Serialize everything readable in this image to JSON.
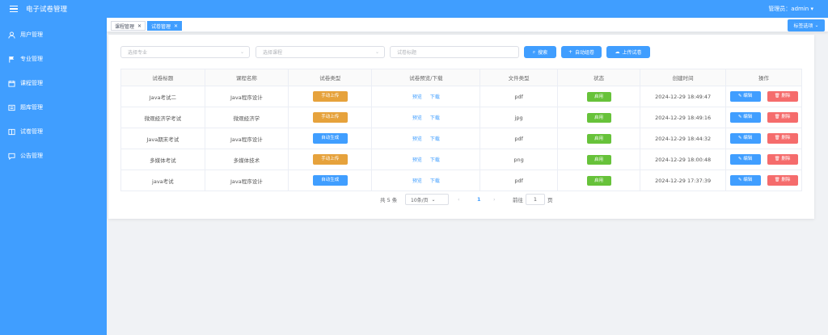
{
  "app": {
    "title": "电子试卷管理",
    "admin": "管理员：admin"
  },
  "sidebar": {
    "items": [
      {
        "label": "用户管理",
        "icon": "user-icon"
      },
      {
        "label": "专业管理",
        "icon": "flag-icon"
      },
      {
        "label": "课程管理",
        "icon": "calendar-icon"
      },
      {
        "label": "题库管理",
        "icon": "bank-icon"
      },
      {
        "label": "试卷管理",
        "icon": "book-icon"
      },
      {
        "label": "公告管理",
        "icon": "chat-icon"
      }
    ]
  },
  "tabs": [
    {
      "label": "课程管理",
      "active": false
    },
    {
      "label": "试卷管理",
      "active": true
    }
  ],
  "tab_options": "标签选项",
  "filters": {
    "major_placeholder": "选择专业",
    "course_placeholder": "选择课程",
    "title_placeholder": "试卷标题"
  },
  "buttons": {
    "search": "搜索",
    "auto": "自动组卷",
    "upload": "上传试卷"
  },
  "table": {
    "headers": [
      "试卷标题",
      "课程名称",
      "试卷类型",
      "试卷预览/下载",
      "文件类型",
      "状态",
      "创建时间",
      "操作"
    ],
    "preview_label": "预览",
    "download_label": "下载",
    "edit_label": "编辑",
    "delete_label": "删除",
    "rows": [
      {
        "title": "Java考试二",
        "course": "Java程序设计",
        "type": "手动上传",
        "type_color": "orange",
        "file": "pdf",
        "status": "启用",
        "created": "2024-12-29 18:49:47"
      },
      {
        "title": "微观经济学考试",
        "course": "微观经济学",
        "type": "手动上传",
        "type_color": "orange",
        "file": "jpg",
        "status": "启用",
        "created": "2024-12-29 18:49:16"
      },
      {
        "title": "Java期末考试",
        "course": "Java程序设计",
        "type": "自动生成",
        "type_color": "blue",
        "file": "pdf",
        "status": "启用",
        "created": "2024-12-29 18:44:32"
      },
      {
        "title": "多媒体考试",
        "course": "多媒体技术",
        "type": "手动上传",
        "type_color": "orange",
        "file": "png",
        "status": "启用",
        "created": "2024-12-29 18:00:48"
      },
      {
        "title": "java考试",
        "course": "Java程序设计",
        "type": "自动生成",
        "type_color": "blue",
        "file": "pdf",
        "status": "启用",
        "created": "2024-12-29 17:37:39"
      }
    ]
  },
  "pagination": {
    "total": "共 5 条",
    "page_size": "10条/页",
    "current": "1",
    "goto_prefix": "前往",
    "goto_value": "1",
    "goto_suffix": "页"
  },
  "colors": {
    "primary": "#409eff",
    "warning": "#e6a23c",
    "success": "#67c23a",
    "danger": "#f56c6c"
  }
}
